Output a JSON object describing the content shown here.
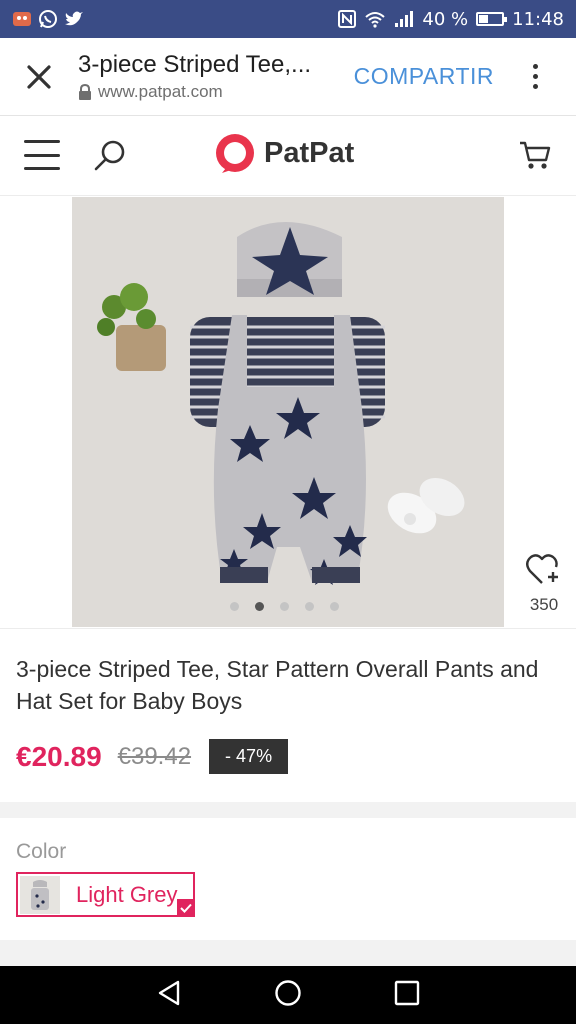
{
  "status_bar": {
    "battery_percent_text": "40 %",
    "battery_level": 0.4,
    "time": "11:48",
    "icons": [
      "notification-app-icon",
      "whatsapp-icon",
      "twitter-icon",
      "nfc-icon",
      "wifi-icon",
      "signal-icon",
      "battery-icon"
    ]
  },
  "tab": {
    "title": "3-piece Striped Tee,...",
    "url": "www.patpat.com",
    "share_label": "COMPARTIR"
  },
  "site": {
    "logo_text": "PatPat",
    "brand_color": "#e0245e"
  },
  "product": {
    "image_dots": 5,
    "active_dot": 1,
    "favorite_count": "350",
    "title": "3-piece Striped Tee, Star Pattern Overall Pants and Hat Set for Baby Boys",
    "price": "€20.89",
    "old_price": "€39.42",
    "discount": "- 47%"
  },
  "color": {
    "label": "Color",
    "selected": "Light Grey"
  }
}
